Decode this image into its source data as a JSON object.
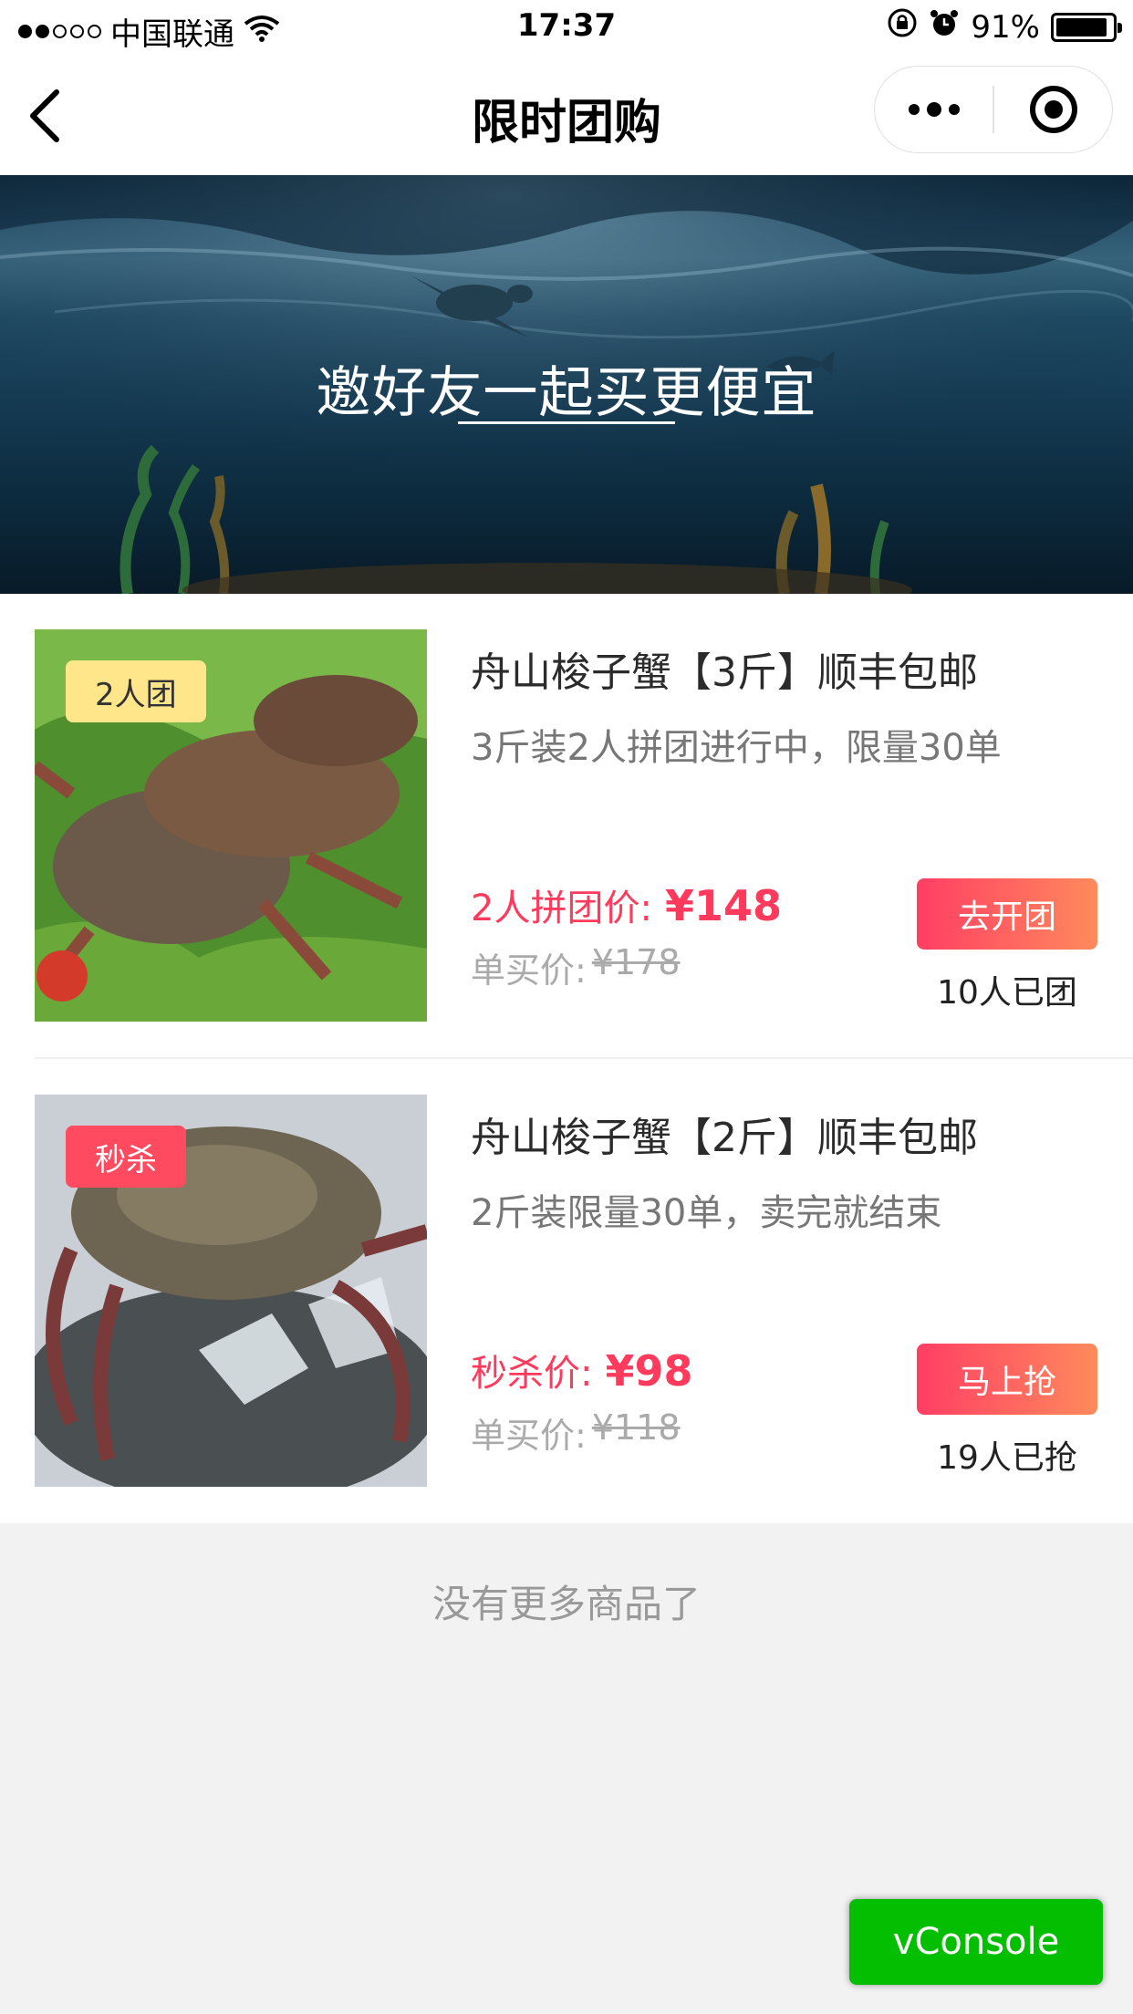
{
  "status_bar": {
    "carrier": "中国联通",
    "time": "17:37",
    "battery": "91%",
    "battery_level": 0.91,
    "icons": [
      "signal-dots-icon",
      "wifi-icon",
      "orientation-lock-icon",
      "alarm-icon",
      "battery-icon"
    ]
  },
  "nav": {
    "title": "限时团购",
    "back_icon": "chevron-left-icon",
    "menu_icon": "more-dots-icon",
    "close_icon": "target-circle-icon"
  },
  "banner": {
    "text": "邀好友一起买更便宜"
  },
  "products": [
    {
      "tag": "2人团",
      "title": "舟山梭子蟹【3斤】顺丰包邮",
      "desc": "3斤装2人拼团进行中，限量30单",
      "price_label": "2人拼团价:",
      "price": "¥148",
      "orig_label": "单买价:",
      "orig_price": "¥178",
      "button": "去开团",
      "count": "10人已团"
    },
    {
      "tag": "秒杀",
      "title": "舟山梭子蟹【2斤】顺丰包邮",
      "desc": "2斤装限量30单，卖完就结束",
      "price_label": "秒杀价:",
      "price": "¥98",
      "orig_label": "单买价:",
      "orig_price": "¥118",
      "button": "马上抢",
      "count": "19人已抢"
    }
  ],
  "footer": {
    "no_more": "没有更多商品了",
    "vconsole": "vConsole"
  },
  "colors": {
    "accent_red": "#ff3a5c",
    "button_gradient_start": "#ff3e64",
    "button_gradient_end": "#ff8a5c",
    "tag_yellow": "#ffe68a",
    "vconsole_green": "#04be02"
  }
}
